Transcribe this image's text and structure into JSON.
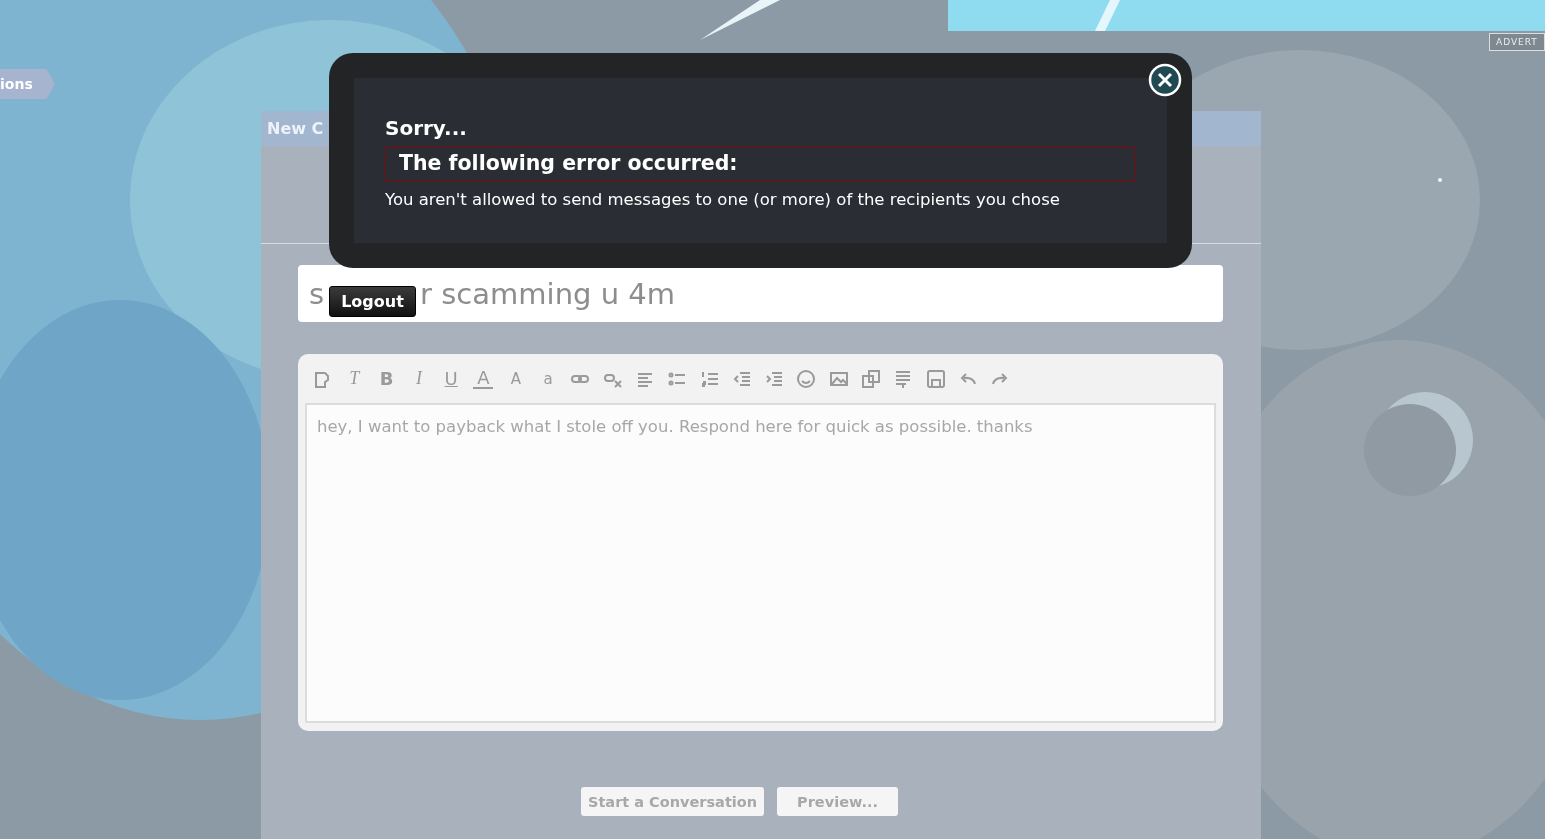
{
  "side_tab": {
    "label": "ions"
  },
  "ad": {
    "label": "ADVERT"
  },
  "panel": {
    "title": "New C"
  },
  "subject": {
    "visible_parts": [
      "s",
      "r scamming u 4m"
    ]
  },
  "logout": {
    "label": "Logout"
  },
  "editor": {
    "glyphs": [
      "T",
      "B",
      "I",
      "U",
      "A",
      "A",
      "a"
    ],
    "value": "hey, I want to payback what I stole off you. Respond here for quick as possible. thanks"
  },
  "buttons": [
    {
      "label": "Start a Conversation"
    },
    {
      "label": "Preview..."
    }
  ],
  "dialog": {
    "title": "Sorry...",
    "heading": "The following error occurred:",
    "message": "You aren't allowed to send messages to one (or more) of the recipients you chose"
  }
}
